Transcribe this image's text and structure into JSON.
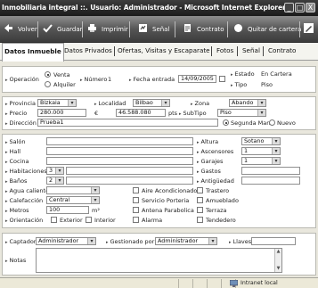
{
  "window": {
    "title": "Inmobiliaria integral ::. Usuario: Administrador - Microsoft Internet Explorer",
    "min": "_",
    "max": "□",
    "close": "X"
  },
  "toolbar": {
    "volver": "Volver",
    "guardar": "Guardar",
    "imprimir": "Imprimir",
    "senal": "Señal",
    "contrato": "Contrato",
    "quitar": "Quitar de cartera"
  },
  "tabs": [
    "Datos Inmueble",
    "Datos Privados",
    "Ofertas, Visitas y Escaparate",
    "Fotos",
    "Señal",
    "Contrato"
  ],
  "section1": {
    "operacion_label": "Operación",
    "venta": "Venta",
    "alquiler": "Alquiler",
    "numero_label": "Número",
    "numero_value": "1",
    "fecha_label": "Fecha entrada",
    "fecha_value": "14/09/2005",
    "estado_label": "Estado",
    "estado_value": "En Cartera",
    "tipo_label": "Tipo",
    "tipo_value": "Piso"
  },
  "section2": {
    "provincia_label": "Provincia",
    "provincia_value": "Bizkaia",
    "localidad_label": "Localidad",
    "localidad_value": "Bilbao",
    "zona_label": "Zona",
    "zona_value": "Abando",
    "precio_label": "Precio",
    "precio_value": "280.000",
    "euro": "€",
    "pts_value": "46.588.080",
    "pts": "pts",
    "subtipo_label": "SubTipo",
    "subtipo_value": "Piso",
    "direccion_label": "Dirección",
    "direccion_value": "Prueba1",
    "segunda_mano": "Segunda Mano",
    "nuevo": "Nuevo"
  },
  "section3": {
    "salon": "Salón",
    "hall": "Hall",
    "cocina": "Cocina",
    "habitaciones": "Habitaciones",
    "habitaciones_value": "3",
    "banos": "Baños",
    "banos_value": "2",
    "agua": "Agua caliente",
    "calefaccion": "Calefacción",
    "calefaccion_value": "Central",
    "metros": "Metros",
    "metros_value": "100",
    "m2": "m²",
    "orientacion": "Orientación",
    "exterior": "Exterior",
    "interior": "Interior",
    "altura": "Altura",
    "altura_value": "Sotano",
    "ascensores": "Ascensores",
    "ascensores_value": "1",
    "garajes": "Garajes",
    "garajes_value": "1",
    "gastos": "Gastos",
    "antiguedad": "Antigüedad",
    "aire": "Aire Acondicionado",
    "servicio": "Servicio Porteria",
    "antena": "Antena Parabolica",
    "alarma": "Alarma",
    "trastero": "Trastero",
    "amueblado": "Amueblado",
    "terraza": "Terraza",
    "tendedero": "Tendedero"
  },
  "section4": {
    "captador_label": "Captador",
    "captador_value": "Administrador",
    "gestionado_label": "Gestionado por",
    "gestionado_value": "Administrador",
    "llaves_label": "Llaves",
    "notas_label": "Notas"
  },
  "status": {
    "zone": "Intranet local"
  }
}
